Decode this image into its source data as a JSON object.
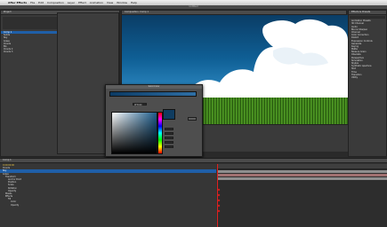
{
  "menubar": {
    "app_name": "After Effects",
    "items": [
      "File",
      "Edit",
      "Composition",
      "Layer",
      "Effect",
      "Animation",
      "View",
      "Window",
      "Help"
    ]
  },
  "window_title": "Untitled",
  "project_panel": {
    "title": "Project",
    "items": [
      "Comp 1",
      "Solids",
      "Sky",
      "Grass",
      "Clouds",
      "BG",
      "Clouds 2",
      "Clouds 3"
    ]
  },
  "comp_panel": {
    "title": "Composition: Comp 1",
    "zoom": "50%"
  },
  "color_dialog": {
    "title": "Solid Color",
    "hex_value": "0F3C60"
  },
  "effects_panel": {
    "title": "Effects & Presets",
    "items": [
      "Animation Presets",
      "3D Channel",
      "Audio",
      "Blur & Sharpen",
      "Channel",
      "Color Correction",
      "Distort",
      "Expression Controls",
      "Generate",
      "Keying",
      "Matte",
      "Noise & Grain",
      "Obsolete",
      "Perspective",
      "Simulation",
      "Stylize",
      "Synthetic Aperture",
      "Text",
      "Time",
      "Transition",
      "Utility"
    ]
  },
  "timeline": {
    "title": "Comp 1",
    "timecode": "0:00:00:00",
    "layers": [
      "Clouds",
      "Sky",
      "Grass"
    ],
    "properties": [
      "Transform",
      "Anchor Point",
      "Position",
      "Scale",
      "Rotation",
      "Opacity",
      "Masks",
      "Effects",
      "Fill",
      "Color",
      "Opacity"
    ]
  },
  "colors": {
    "accent": "#1f5fa8",
    "sky_dark": "#0a3d66",
    "grass": "#3e7f1b",
    "keyframe": "#e02020"
  }
}
